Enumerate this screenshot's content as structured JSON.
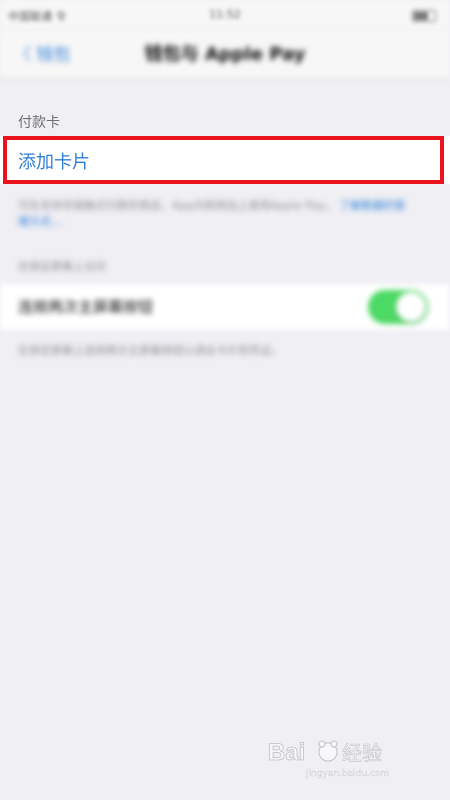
{
  "status_bar": {
    "carrier": "中国联通 令",
    "time": "11:52",
    "battery_text": "● 100%"
  },
  "nav": {
    "back_label": "〈 钱包",
    "title": "钱包与 Apple Pay"
  },
  "payment_cards": {
    "section_header": "付款卡",
    "add_card_label": "添加卡片",
    "footer_note": "可在支持非接触式付款的商店、App内和网站上使用Apple Pay。",
    "footer_link": "了解数据的管理方式…"
  },
  "options": {
    "section_header": "在锁定屏幕上访问",
    "toggle_label": "连按两次主屏幕按钮",
    "toggle_on": true,
    "footer_note": "在锁定屏幕上连按两次主屏幕按钮以调出卡片和凭证。"
  },
  "watermark": {
    "text": "Baidu 经验",
    "url": "jingyan.baidu.com"
  },
  "colors": {
    "accent": "#2f7fd6",
    "highlight": "#e8131b",
    "toggle_on": "#4cd964",
    "background": "#efeff4"
  }
}
